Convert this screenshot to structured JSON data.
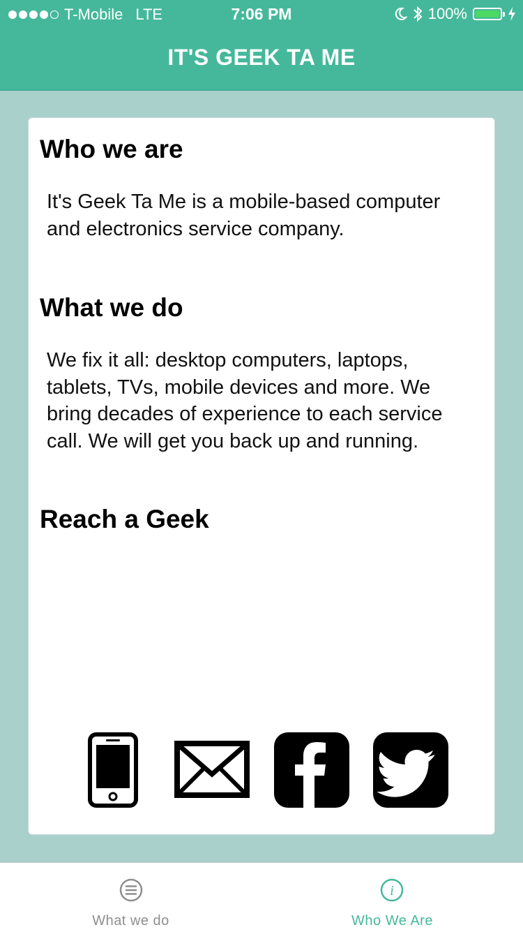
{
  "status_bar": {
    "carrier": "T-Mobile",
    "network": "LTE",
    "time": "7:06 PM",
    "battery": "100%",
    "icons": [
      "signal-dots",
      "moon-icon",
      "bluetooth-icon",
      "battery-icon",
      "charging-bolt-icon"
    ]
  },
  "header": {
    "title": "IT'S GEEK TA ME"
  },
  "content": {
    "sections": [
      {
        "title": "Who we are",
        "body": "It's Geek Ta Me is a mobile-based computer and electronics service company."
      },
      {
        "title": "What we do",
        "body": "We fix it all: desktop computers, laptops, tablets, TVs, mobile devices and more. We bring decades of experience to each service call. We will get you back up and running."
      },
      {
        "title": "Reach a Geek"
      }
    ],
    "contact_icons": [
      "phone-icon",
      "email-icon",
      "facebook-icon",
      "twitter-icon"
    ]
  },
  "tab_bar": {
    "tabs": [
      {
        "label": "What we do",
        "icon": "list-icon",
        "active": false
      },
      {
        "label": "Who We Are",
        "icon": "info-icon",
        "active": true
      }
    ]
  },
  "colors": {
    "header": "#45b89b",
    "background": "#a9d0cb",
    "card": "#ffffff",
    "active_tab": "#45b89b",
    "inactive_tab": "#8e8e8e",
    "battery_fill": "#4cd964"
  }
}
